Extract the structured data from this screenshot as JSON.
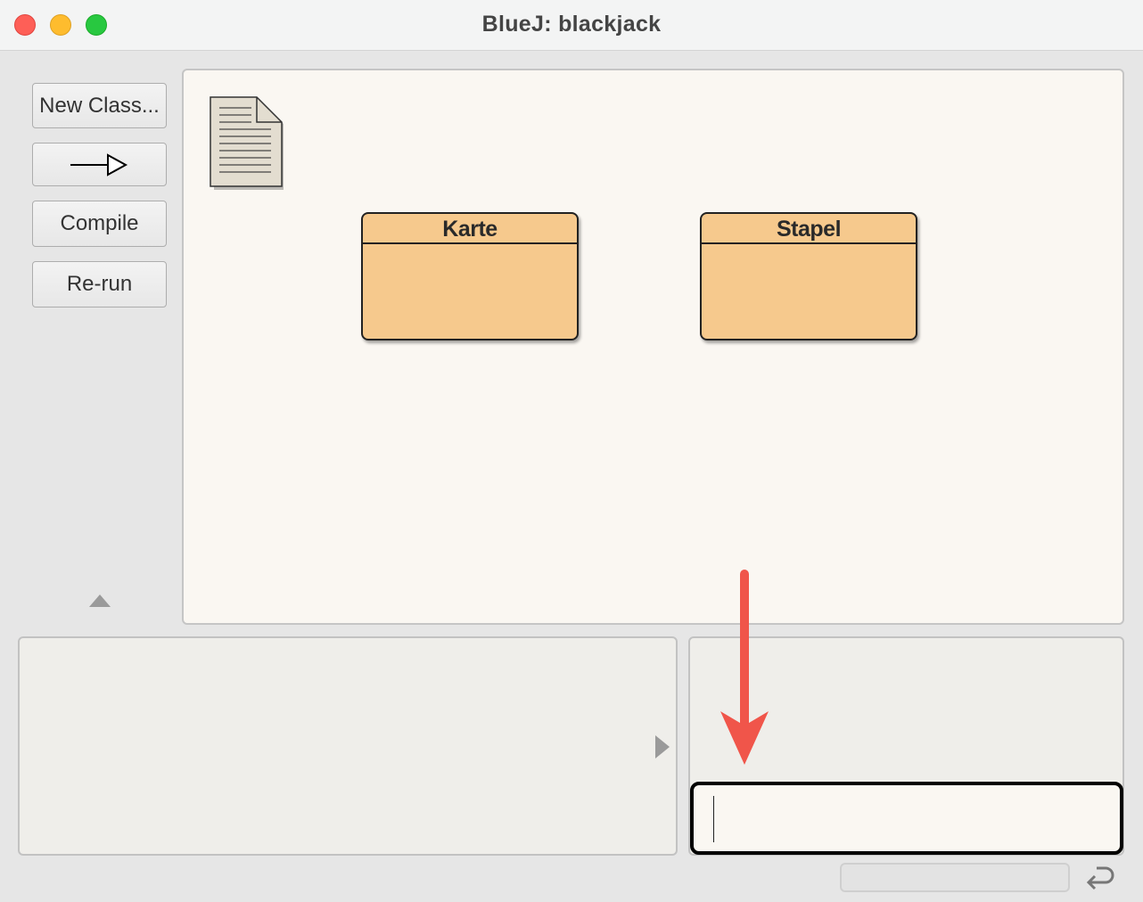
{
  "window": {
    "title": "BlueJ:  blackjack"
  },
  "toolbar": {
    "new_class_label": "New Class...",
    "compile_label": "Compile",
    "rerun_label": "Re-run"
  },
  "icons": {
    "close": "close-icon",
    "minimize": "minimize-icon",
    "zoom": "zoom-icon",
    "inheritance_arrow": "inheritance-arrow-icon",
    "readme": "document-icon",
    "collapse": "triangle-up-icon",
    "expand": "triangle-right-icon",
    "annotation": "red-arrow-down-icon",
    "return": "return-icon"
  },
  "diagram": {
    "classes": [
      {
        "name": "Karte"
      },
      {
        "name": "Stapel"
      }
    ]
  },
  "colors": {
    "class_fill": "#f6c98d",
    "canvas_bg": "#faf7f2",
    "annotation_arrow": "#f0554a"
  }
}
